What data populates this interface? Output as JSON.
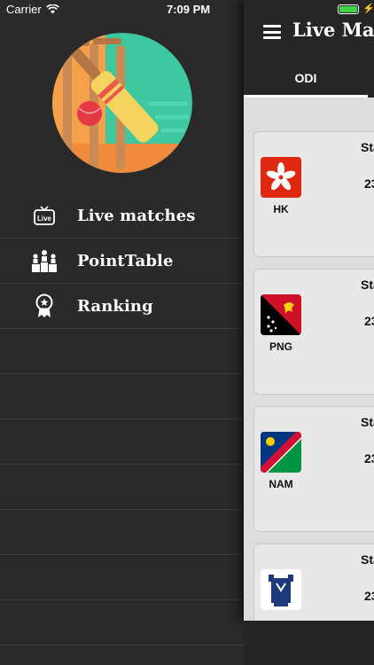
{
  "status_bar": {
    "carrier": "Carrier",
    "time": "7:09 PM",
    "battery_color": "#3fd34a"
  },
  "drawer": {
    "menu": [
      {
        "label": "Live matches",
        "icon": "live-tv-icon"
      },
      {
        "label": "PointTable",
        "icon": "podium-icon"
      },
      {
        "label": "Ranking",
        "icon": "award-ribbon-icon"
      }
    ]
  },
  "main": {
    "title": "Live Matc",
    "tabs": [
      {
        "label": "ODI",
        "selected": true
      }
    ],
    "matches": [
      {
        "team": "HK",
        "status": "Sta",
        "score": "23",
        "flag": "hong-kong-flag"
      },
      {
        "team": "PNG",
        "status": "Sta",
        "score": "23",
        "flag": "png-flag"
      },
      {
        "team": "NAM",
        "status": "Sta",
        "score": "23",
        "flag": "namibia-flag"
      },
      {
        "team": "",
        "status": "Sta",
        "score": "23",
        "flag": "scotland-crest"
      }
    ]
  },
  "colors": {
    "drawer_bg": "#2a2a2a",
    "nav_bg": "#262626",
    "content_bg": "#dddddd",
    "card_bg": "#e8e8e8"
  }
}
